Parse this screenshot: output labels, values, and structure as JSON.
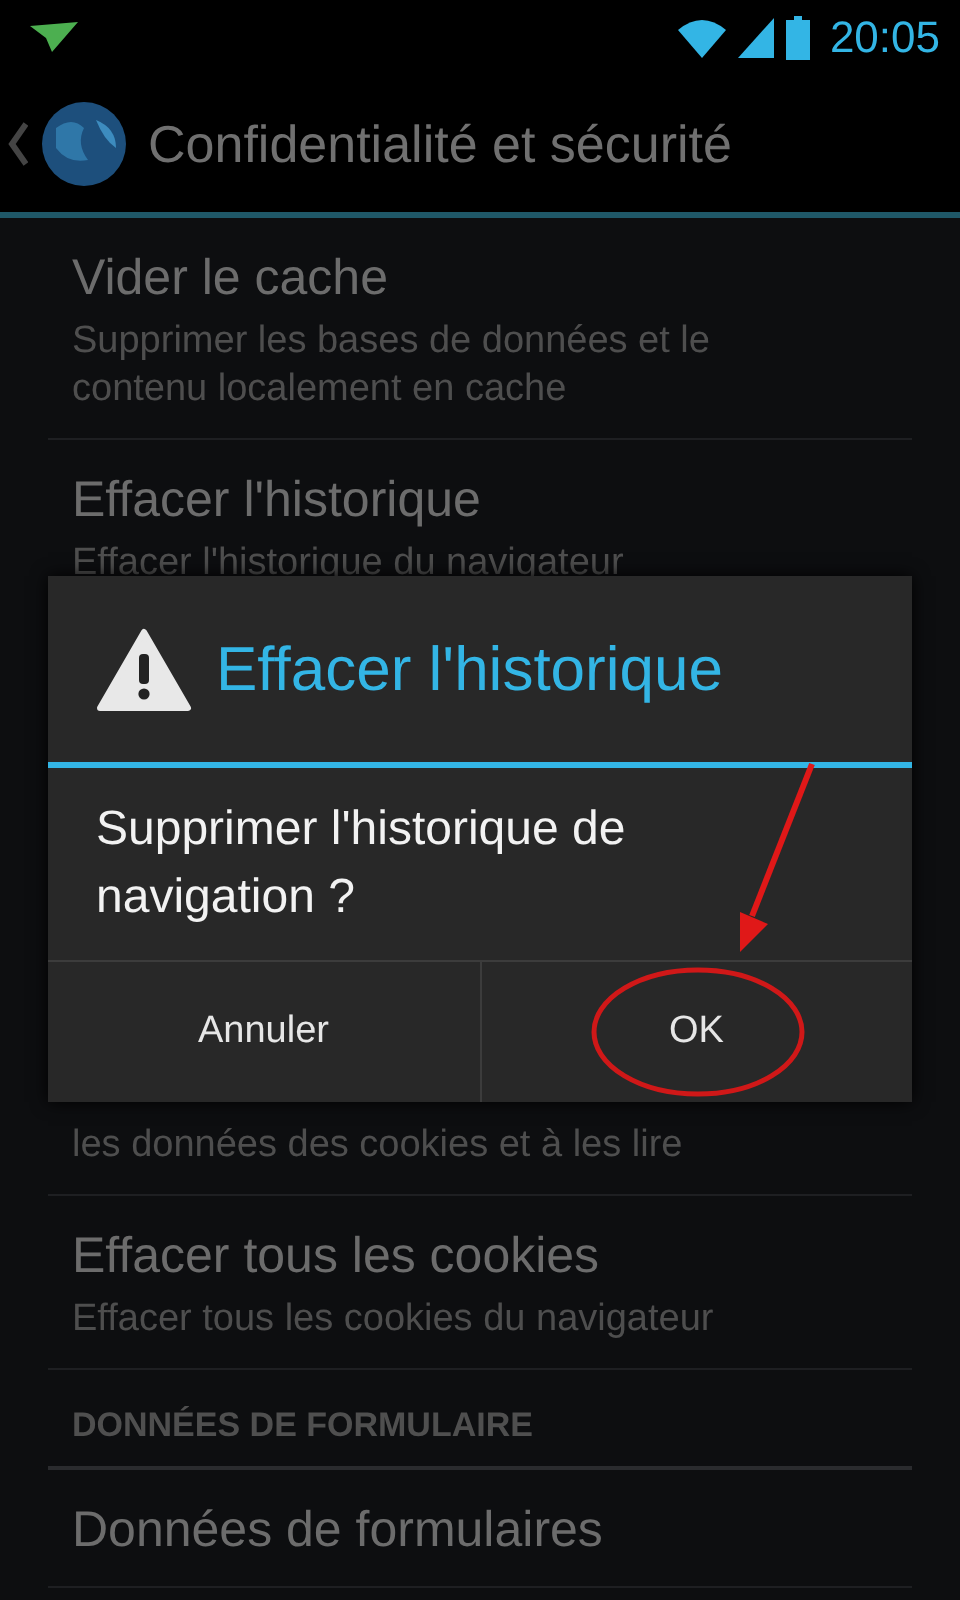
{
  "status_bar": {
    "time": "20:05"
  },
  "action_bar": {
    "title": "Confidentialité et sécurité"
  },
  "settings": [
    {
      "kind": "item",
      "title": "Vider le cache",
      "summary": "Supprimer les bases de données et le contenu localement en cache"
    },
    {
      "kind": "item",
      "title": "Effacer l'historique",
      "summary": "Effacer l'historique du navigateur"
    },
    {
      "kind": "covered",
      "summary": "les données des cookies et à les lire"
    },
    {
      "kind": "item",
      "title": "Effacer tous les cookies",
      "summary": "Effacer tous les cookies du navigateur"
    },
    {
      "kind": "header",
      "title": "DONNÉES DE FORMULAIRE"
    },
    {
      "kind": "item",
      "title": "Données de formulaires"
    }
  ],
  "dialog": {
    "title": "Effacer l'historique",
    "message": "Supprimer l'historique de navigation ?",
    "buttons": [
      "Annuler",
      "OK"
    ]
  }
}
